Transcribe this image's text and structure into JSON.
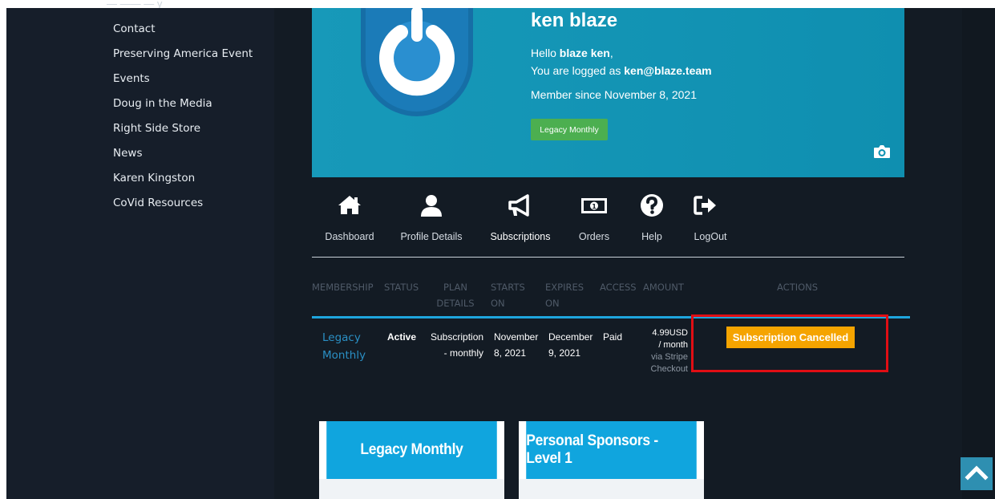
{
  "sidebar": {
    "items": [
      {
        "label": "Contact"
      },
      {
        "label": "Preserving America Event"
      },
      {
        "label": "Events"
      },
      {
        "label": "Doug in the Media"
      },
      {
        "label": "Right Side Store"
      },
      {
        "label": "News"
      },
      {
        "label": "Karen Kingston"
      },
      {
        "label": "CoVid Resources"
      }
    ]
  },
  "profile": {
    "name": "ken blaze",
    "hello_prefix": "Hello ",
    "hello_name": "blaze ken",
    "hello_suffix": ",",
    "logged_prefix": "You are logged as ",
    "email": "ken@blaze.team",
    "member_since": "Member since November 8, 2021",
    "plan_badge": "Legacy Monthly",
    "camera_icon": "camera-icon",
    "avatar_icon": "power-icon"
  },
  "nav": {
    "items": [
      {
        "label": "Dashboard",
        "icon": "home-icon"
      },
      {
        "label": "Profile Details",
        "icon": "user-icon"
      },
      {
        "label": "Subscriptions",
        "icon": "megaphone-icon",
        "active": true
      },
      {
        "label": "Orders",
        "icon": "money-icon"
      },
      {
        "label": "Help",
        "icon": "question-icon"
      },
      {
        "label": "LogOut",
        "icon": "logout-icon"
      }
    ]
  },
  "table": {
    "headers": {
      "membership": "MEMBERSHIP",
      "status": "STATUS",
      "plan_l1": "PLAN",
      "plan_l2": "DETAILS",
      "starts_l1": "STARTS",
      "starts_l2": "ON",
      "expires_l1": "EXPIRES",
      "expires_l2": "ON",
      "access": "ACCESS",
      "amount": "AMOUNT",
      "actions": "ACTIONS"
    },
    "row": {
      "membership_l1": "Legacy",
      "membership_l2": "Monthly",
      "status": "Active",
      "plan_l1": "Subscription",
      "plan_l2": "- monthly",
      "starts_l1": "November",
      "starts_l2": "8, 2021",
      "expires_l1": "December",
      "expires_l2": "9, 2021",
      "access": "Paid",
      "amount_l1": "4.99USD",
      "amount_l2": "/ month",
      "amount_l3": "via Stripe",
      "amount_l4": "Checkout",
      "action": "Subscription Cancelled"
    }
  },
  "plans": [
    {
      "title": "Legacy Monthly"
    },
    {
      "title": "Personal Sponsors - Level 1"
    }
  ],
  "colors": {
    "brand_blue": "#10a5de",
    "badge_green": "#4caf50",
    "action_orange": "#f5a400",
    "highlight_red": "#e00e14"
  },
  "scroll_top_icon": "chevron-up-icon"
}
